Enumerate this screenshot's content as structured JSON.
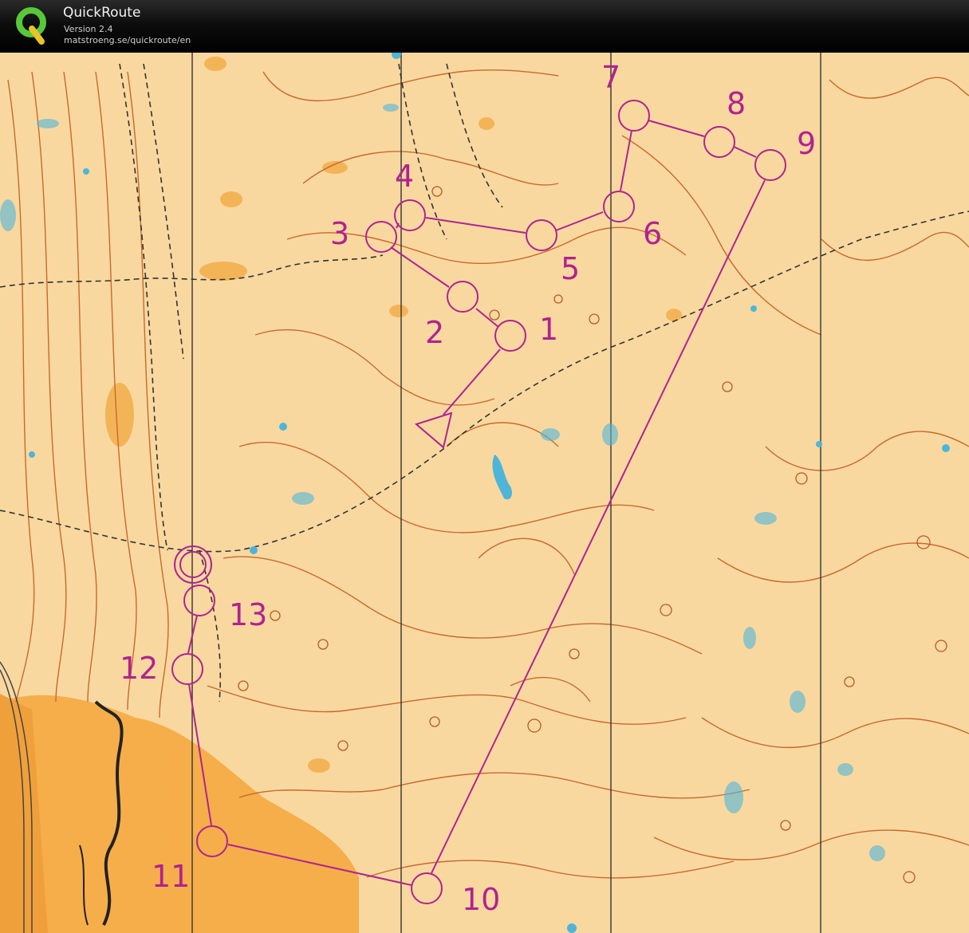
{
  "app": {
    "title": "QuickRoute",
    "version": "Version 2.4",
    "url": "matstroeng.se/quickroute/en",
    "logo_icon": "quickroute-q-logo"
  },
  "map": {
    "type": "orienteering-map",
    "course_color": "#b0238f",
    "controls": [
      {
        "label": "1"
      },
      {
        "label": "2"
      },
      {
        "label": "3"
      },
      {
        "label": "4"
      },
      {
        "label": "5"
      },
      {
        "label": "6"
      },
      {
        "label": "7"
      },
      {
        "label": "8"
      },
      {
        "label": "9"
      },
      {
        "label": "10"
      },
      {
        "label": "11"
      },
      {
        "label": "12"
      },
      {
        "label": "13"
      }
    ]
  }
}
